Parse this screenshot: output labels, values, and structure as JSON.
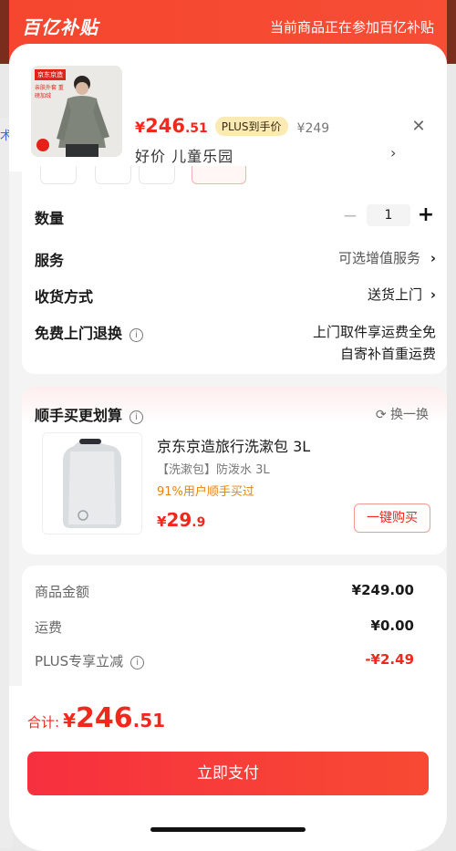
{
  "background": {
    "link_text": "术"
  },
  "banner": {
    "logo": "百亿补贴",
    "note": "当前商品正在参加百亿补贴"
  },
  "product": {
    "price_currency": "¥",
    "price_int": "246",
    "price_dec": ".51",
    "plus_badge": "PLUS到手价",
    "orig_price": "¥249",
    "spec": "好价  儿童乐园",
    "thumb_tag": "京东京造",
    "thumb_sub": "亲肤外套 重磅加绒"
  },
  "order": {
    "quantity_label": "数量",
    "quantity_value": "1",
    "service_label": "服务",
    "service_value": "可选增值服务",
    "delivery_label": "收货方式",
    "delivery_value": "送货上门",
    "return_label": "免费上门退换",
    "return_line1": "上门取件享运费全免",
    "return_line2": "自寄补首重运费"
  },
  "upsell": {
    "title": "顺手买更划算",
    "refresh": "换一换",
    "name": "京东京造旅行洗漱包 3L",
    "tag": "【洗漱包】防泼水 3L",
    "rate": "91%用户顺手买过",
    "price_currency": "¥",
    "price_int": "29",
    "price_dec": ".9",
    "buy_label": "一键购买"
  },
  "summary": {
    "goods_label": "商品金额",
    "goods_value": "¥249.00",
    "shipping_label": "运费",
    "shipping_value": "¥0.00",
    "plus_label": "PLUS专享立减",
    "plus_value": "-¥2.49"
  },
  "footer": {
    "total_label": "合计:",
    "total_currency": "¥",
    "total_int": "246",
    "total_dec": ".51",
    "pay_label": "立即支付"
  },
  "colors": {
    "accent": "#f0291c",
    "banner": "#f5462f",
    "plus_badge": "#fbeab3",
    "rate": "#e8840c"
  }
}
